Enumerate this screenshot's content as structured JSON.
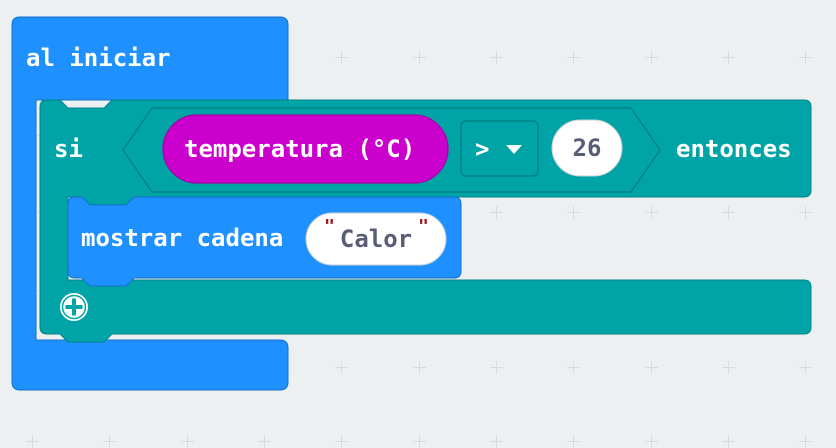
{
  "editor": {
    "on_start_block": {
      "label": "al iniciar",
      "color": "#1e90ff"
    },
    "if_block": {
      "if_label": "si",
      "then_label": "entonces",
      "color": "#00a4a6",
      "add_branch_icon": "plus-circle-icon",
      "condition": {
        "left_reporter": "temperatura (°C)",
        "left_color": "#cc00cc",
        "operator": ">",
        "operator_dropdown_icon": "triangle-down-icon",
        "right_value": "26"
      }
    },
    "show_string_block": {
      "label": "mostrar cadena",
      "value": "Calor",
      "quote_color": "#a31515",
      "color": "#1e90ff"
    }
  }
}
